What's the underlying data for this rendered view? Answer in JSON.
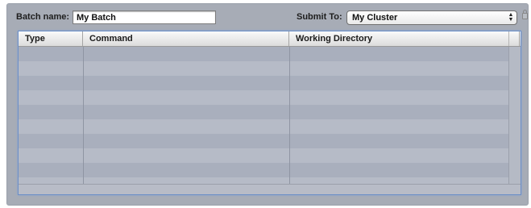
{
  "batch": {
    "label": "Batch name:",
    "value": "My Batch"
  },
  "submit": {
    "label": "Submit To:",
    "selected": "My Cluster"
  },
  "table": {
    "columns": [
      "Type",
      "Command",
      "Working Directory"
    ],
    "rows": []
  },
  "colors": {
    "panel_background": "#a7acb6",
    "table_focus_ring": "#6c8fc7",
    "row_stripe_a": "#a9afbd",
    "row_stripe_b": "#b6bbc7"
  },
  "icons": {
    "lock": "lock-icon",
    "select_arrows": "updown-arrows-icon"
  }
}
